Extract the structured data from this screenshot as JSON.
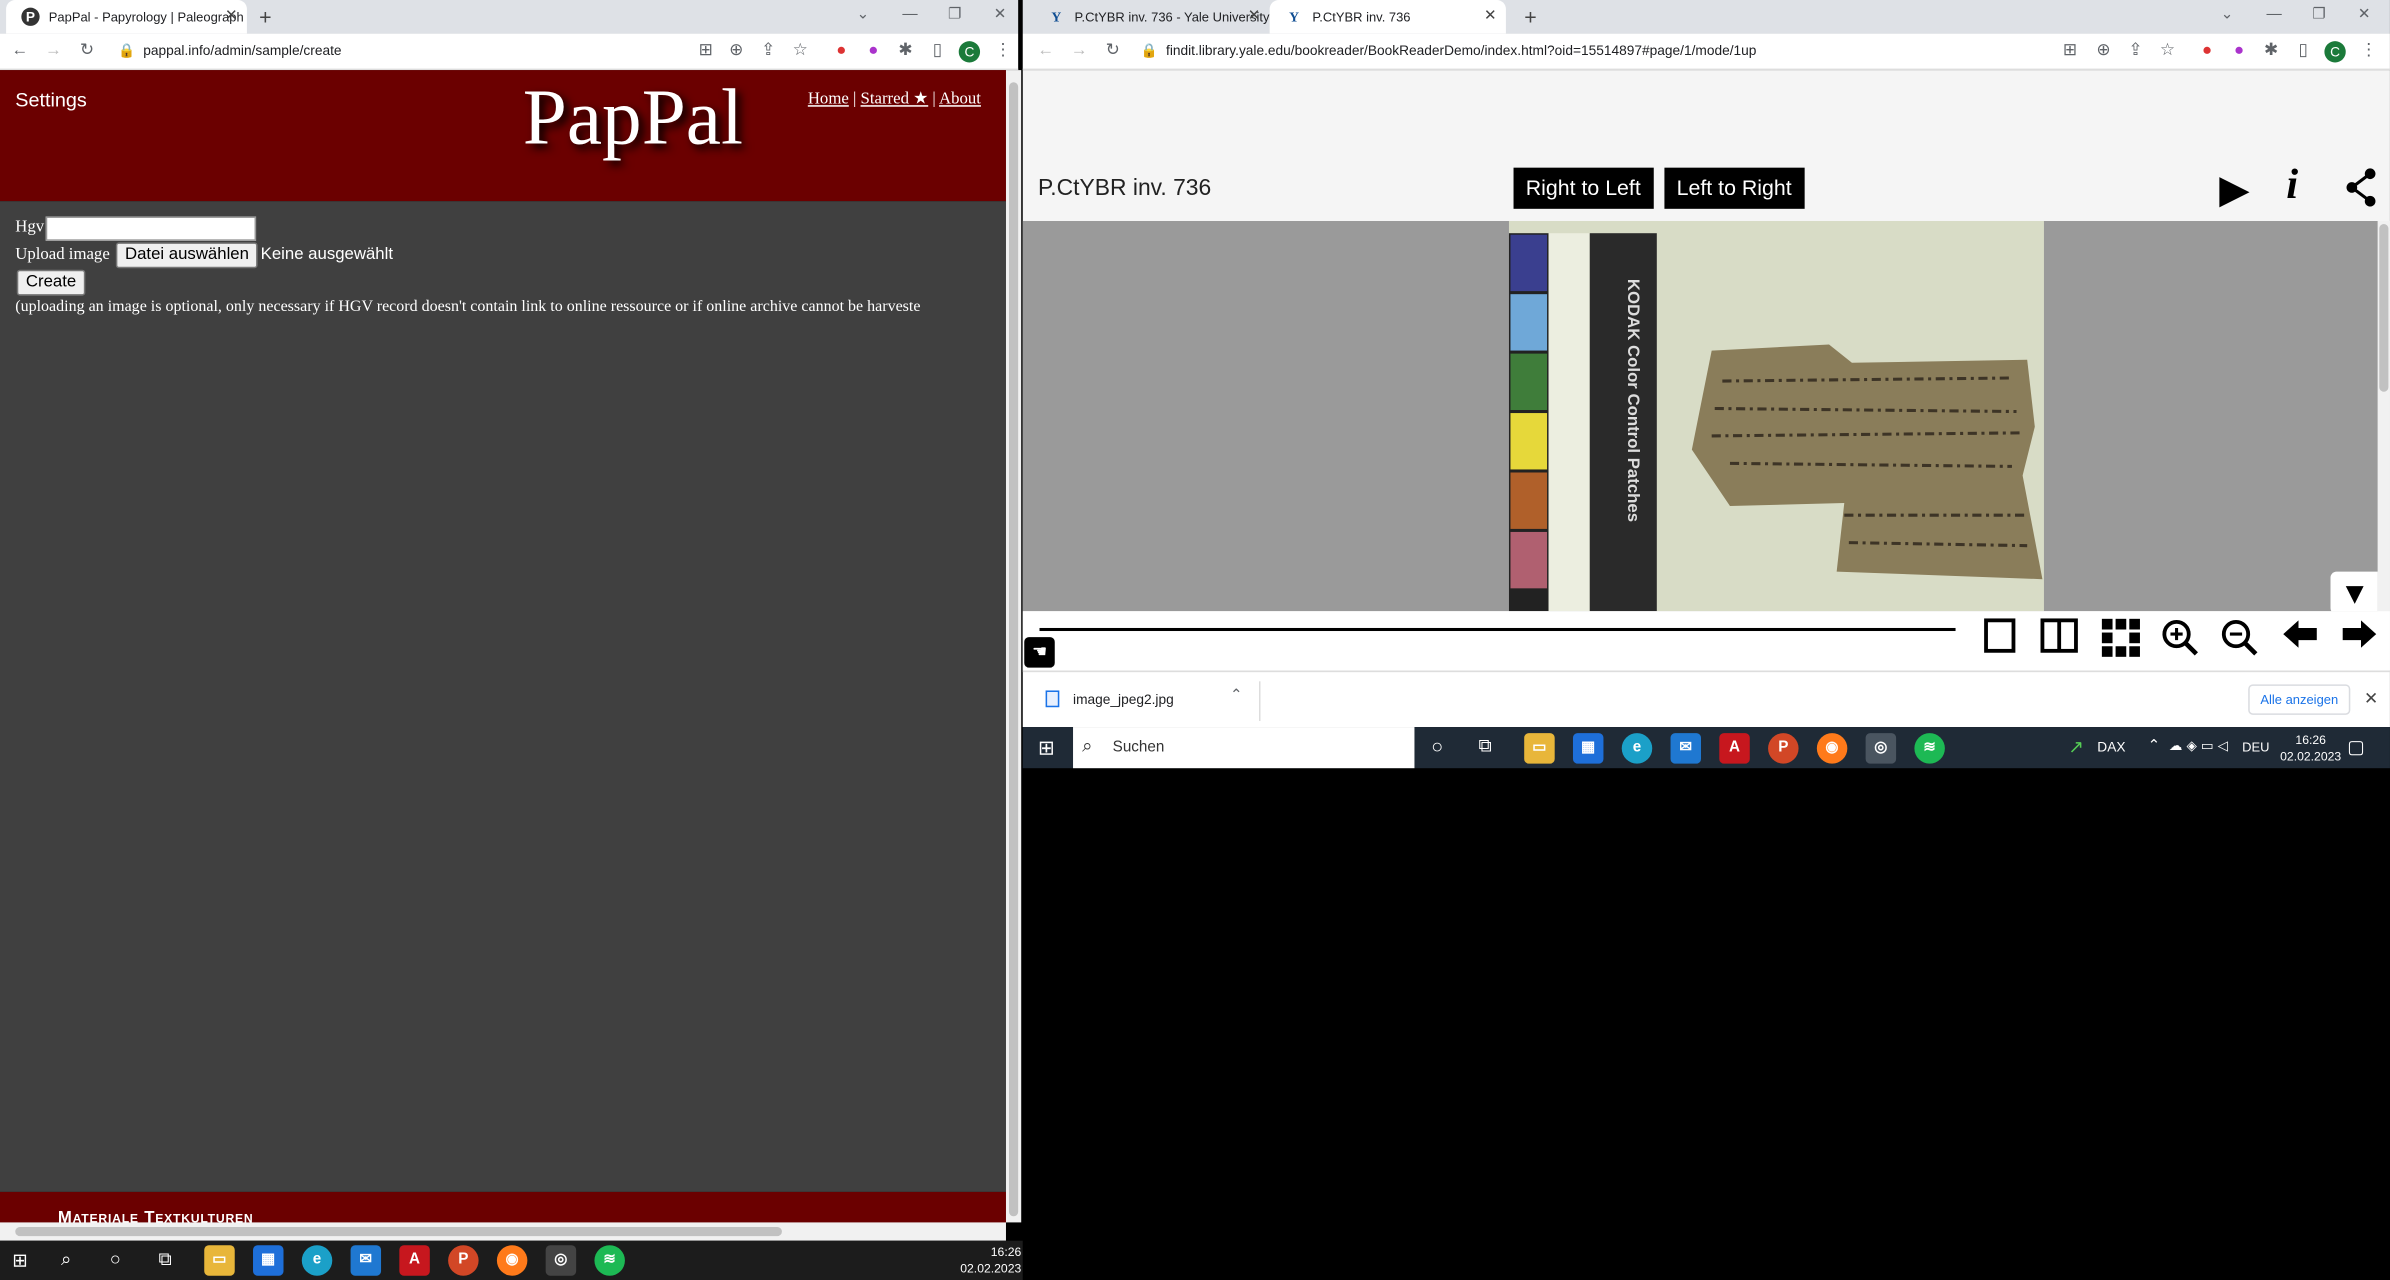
{
  "left_browser": {
    "tabs": [
      {
        "title": "PapPal - Papyrology | Paleograph",
        "favicon": "P"
      }
    ],
    "url": "pappal.info/admin/sample/create",
    "profile_letter": "C"
  },
  "pappal": {
    "settings_label": "Settings",
    "logo_text": "PapPal",
    "nav": {
      "home": "Home",
      "starred": "Starred ★",
      "about": "About",
      "separator": "|"
    },
    "form": {
      "hgv_label": "Hgv",
      "hgv_value": "",
      "upload_label": "Upload image",
      "file_button": "Datei auswählen",
      "file_status": "Keine ausgewählt",
      "create_button": "Create",
      "note": "(uploading an image is optional, only necessary if HGV record doesn't contain link to online ressource or if online archive cannot be harveste"
    },
    "footer_text": "Materiale Textkulturen",
    "colors": {
      "header": "#6b0000",
      "body": "#404040",
      "footer": "#6b0000"
    }
  },
  "right_browser": {
    "tabs": [
      {
        "title": "P.CtYBR inv. 736 - Yale University",
        "favicon": "Y"
      },
      {
        "title": "P.CtYBR inv. 736",
        "favicon": "Y"
      }
    ],
    "url": "findit.library.yale.edu/bookreader/BookReaderDemo/index.html?oid=15514897#page/1/mode/1up",
    "profile_letter": "C"
  },
  "bookreader": {
    "title": "P.CtYBR inv. 736",
    "rtl_button": "Right to Left",
    "ltr_button": "Left to Right",
    "scan": {
      "ruler_text": "KODAK Color Control Patches",
      "patch_labels": [
        "Blue",
        "Cyan",
        "Green",
        "Yellow",
        "Red",
        "Magenta"
      ],
      "patch_colors": [
        "#3a3f8f",
        "#6fa8d8",
        "#3f7d3a",
        "#e6d83a",
        "#b0602a",
        "#b06070"
      ]
    },
    "controls": [
      "one-page-icon",
      "two-page-icon",
      "thumbnail-icon",
      "zoom-in-icon",
      "zoom-out-icon",
      "arrow-left-icon",
      "arrow-right-icon"
    ]
  },
  "download_bar": {
    "filename": "image_jpeg2.jpg",
    "show_all": "Alle anzeigen"
  },
  "inner_taskbar": {
    "search_placeholder": "Suchen",
    "stock": "DAX",
    "lang": "DEU",
    "time": "16:26",
    "date": "02.02.2023"
  },
  "outer_taskbar": {
    "time": "16:26",
    "date": "02.02.2023"
  }
}
